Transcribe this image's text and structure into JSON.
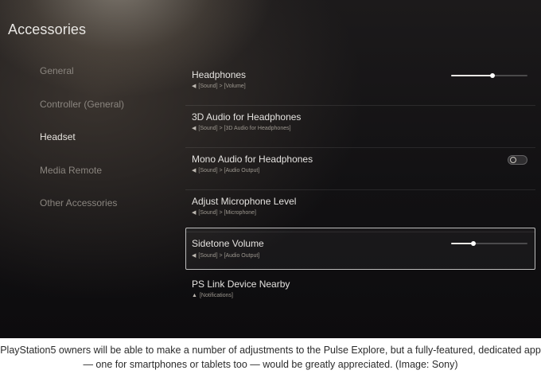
{
  "screen": {
    "title": "Accessories",
    "sidebar": {
      "items": [
        {
          "label": "General",
          "selected": false
        },
        {
          "label": "Controller (General)",
          "selected": false
        },
        {
          "label": "Headset",
          "selected": true
        },
        {
          "label": "Media Remote",
          "selected": false
        },
        {
          "label": "Other Accessories",
          "selected": false
        }
      ]
    },
    "settings": [
      {
        "title": "Headphones",
        "path": "[Sound] > [Volume]",
        "path_icon": "speaker-icon",
        "control": "slider",
        "level": 0.54
      },
      {
        "title": "3D Audio for Headphones",
        "path": "[Sound] > [3D Audio for Headphones]",
        "path_icon": "speaker-icon"
      },
      {
        "title": "Mono Audio for Headphones",
        "path": "[Sound] > [Audio Output]",
        "path_icon": "speaker-icon",
        "control": "toggle",
        "on": false
      },
      {
        "title": "Adjust Microphone Level",
        "path": "[Sound] > [Microphone]",
        "path_icon": "speaker-icon"
      },
      {
        "title": "Sidetone Volume",
        "path": "[Sound] > [Audio Output]",
        "path_icon": "speaker-icon",
        "control": "slider",
        "level": 0.29,
        "focused": true
      },
      {
        "title": "PS Link Device Nearby",
        "path": "[Notifications]",
        "path_icon": "bell-icon"
      }
    ],
    "icons": {
      "speaker": "◀",
      "bell": "▲"
    },
    "colors": {
      "background": "#121113",
      "text_primary": "#e5e3e0",
      "text_dim": "#8a857f",
      "focus_border": "#ebebeb"
    }
  },
  "caption": "PlayStation5 owners will be able to make a number of adjustments to the Pulse Explore, but a fully-featured, dedicated app — one for smartphones or tablets too — would be greatly appreciated. (Image: Sony)"
}
